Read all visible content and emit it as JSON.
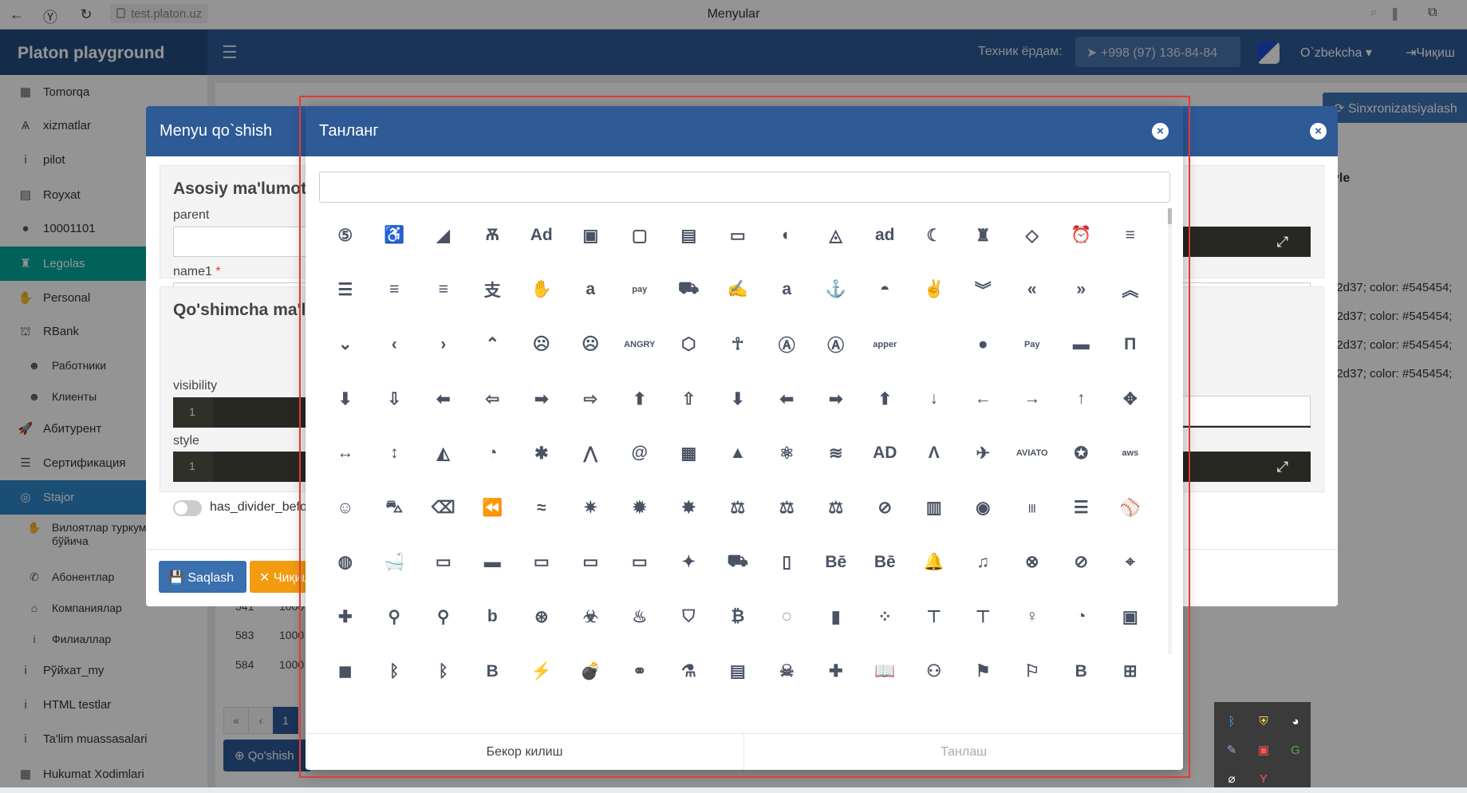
{
  "browser": {
    "url": "test.platon.uz",
    "title": "Menyular"
  },
  "header": {
    "brand": "Platon playground",
    "support_label": "Техник ёрдам:",
    "phone": "+998 (97) 136-84-84",
    "language": "O`zbekcha",
    "exit": "Чиқиш"
  },
  "sidebar": {
    "items": [
      {
        "label": "Tomorqa",
        "icon": "building-icon"
      },
      {
        "label": "xizmatlar",
        "icon": "aviato-icon"
      },
      {
        "label": "pilot",
        "icon": "info-icon"
      },
      {
        "label": "Royxat",
        "icon": "id-card-icon"
      },
      {
        "label": "10001101",
        "icon": "bomb-icon"
      },
      {
        "label": "Legolas",
        "icon": "chess-icon"
      },
      {
        "label": "Personal",
        "icon": "hand-icon"
      },
      {
        "label": "RBank",
        "icon": "bank-icon"
      },
      {
        "label": "Работники",
        "icon": "users-icon"
      },
      {
        "label": "Клиенты",
        "icon": "users-icon"
      },
      {
        "label": "Абитурент",
        "icon": "rocket-icon"
      },
      {
        "label": "Сертификация",
        "icon": "database-icon"
      },
      {
        "label": "Stajor",
        "icon": "circle-icon"
      },
      {
        "label": "Вилоятлар туркуми бўйича",
        "icon": "hand-icon"
      },
      {
        "label": "Абонентлар",
        "icon": "phone-icon"
      },
      {
        "label": "Компаниялар",
        "icon": "industry-icon"
      },
      {
        "label": "Филиаллар",
        "icon": "info-icon"
      },
      {
        "label": "Рўйхат_my",
        "icon": "info-icon"
      },
      {
        "label": "HTML testlar",
        "icon": "info-icon"
      },
      {
        "label": "Ta'lim muassasalari",
        "icon": "info-icon"
      },
      {
        "label": "Hukumat Xodimlari",
        "icon": "building-icon"
      }
    ]
  },
  "background": {
    "sync_button": "Sinxronizatsiyalash",
    "style_header": "yle",
    "style_rows": [
      "42d37; color: #545454;",
      "42d37; color: #545454;",
      "42d37; color: #545454;",
      "42d37; color: #545454;"
    ],
    "rows": [
      {
        "id": "541",
        "val": "1000"
      },
      {
        "id": "583",
        "val": "1000"
      },
      {
        "id": "584",
        "val": "1000"
      }
    ],
    "pager": [
      "«",
      "‹",
      "1"
    ],
    "add_button": "Qo'shish"
  },
  "modal_menu": {
    "title": "Menyu qo`shish",
    "section1_title": "Asosiy ma'lumotlar",
    "parent_label": "parent",
    "name1_label": "name1",
    "required_mark": "*",
    "section2_title": "Qo'shimcha ma'lumotlar",
    "visibility_label": "visibility",
    "style_label": "style",
    "line_no": "1",
    "toggle_label": "has_divider_before",
    "save": "Saqlash",
    "cancel": "Чиқиш"
  },
  "modal_icon": {
    "title": "Танланг",
    "search_value": "",
    "search_placeholder": "",
    "cancel": "Бекор килиш",
    "confirm": "Танлаш",
    "icons": [
      {
        "name": "500px-icon",
        "g": "⑤"
      },
      {
        "name": "accessible-icon",
        "g": "♿"
      },
      {
        "name": "accusoft-icon",
        "g": "◢"
      },
      {
        "name": "acquisitions-icon",
        "g": "Ѫ"
      },
      {
        "name": "ad-icon",
        "g": "Ad"
      },
      {
        "name": "address-book-icon",
        "g": "▣"
      },
      {
        "name": "address-book-outline-icon",
        "g": "▢"
      },
      {
        "name": "address-card-icon",
        "g": "▤"
      },
      {
        "name": "address-card-outline-icon",
        "g": "▭"
      },
      {
        "name": "adjust-icon",
        "g": "◐"
      },
      {
        "name": "adn-icon",
        "g": "◬"
      },
      {
        "name": "adversal-icon",
        "g": "ad"
      },
      {
        "name": "affiliatetheme-icon",
        "g": "☾"
      },
      {
        "name": "air-freshener-icon",
        "g": "♜"
      },
      {
        "name": "airbnb-icon",
        "g": "◇"
      },
      {
        "name": "alarm-clock-icon",
        "g": "⏰"
      },
      {
        "name": "align-center-icon",
        "g": "≡"
      },
      {
        "name": "align-justify-icon",
        "g": "☰"
      },
      {
        "name": "align-left-icon",
        "g": "≡"
      },
      {
        "name": "align-right-icon",
        "g": "≡"
      },
      {
        "name": "alipay-icon",
        "g": "支"
      },
      {
        "name": "allergies-icon",
        "g": "✋"
      },
      {
        "name": "amazon-icon",
        "g": "a"
      },
      {
        "name": "amazon-pay-icon",
        "g": "pay"
      },
      {
        "name": "ambulance-icon",
        "g": "⛟"
      },
      {
        "name": "american-sign-icon",
        "g": "✍"
      },
      {
        "name": "amilia-icon",
        "g": "a"
      },
      {
        "name": "anchor-icon",
        "g": "⚓"
      },
      {
        "name": "android-icon",
        "g": "◓"
      },
      {
        "name": "angellist-icon",
        "g": "✌"
      },
      {
        "name": "angle-double-down-icon",
        "g": "︾"
      },
      {
        "name": "angle-double-left-icon",
        "g": "«"
      },
      {
        "name": "angle-double-right-icon",
        "g": "»"
      },
      {
        "name": "angle-double-up-icon",
        "g": "︽"
      },
      {
        "name": "angle-down-icon",
        "g": "⌄"
      },
      {
        "name": "angle-left-icon",
        "g": "‹"
      },
      {
        "name": "angle-right-icon",
        "g": "›"
      },
      {
        "name": "angle-up-icon",
        "g": "⌃"
      },
      {
        "name": "angry-icon",
        "g": "☹"
      },
      {
        "name": "angry-outline-icon",
        "g": "☹"
      },
      {
        "name": "angrycreative-icon",
        "g": "ANGRY"
      },
      {
        "name": "angular-icon",
        "g": "⬡"
      },
      {
        "name": "ankh-icon",
        "g": "☥"
      },
      {
        "name": "app-store-icon",
        "g": "Ⓐ"
      },
      {
        "name": "app-store-ios-icon",
        "g": "Ⓐ"
      },
      {
        "name": "apper-icon",
        "g": "apper"
      },
      {
        "name": "apple-icon",
        "g": ""
      },
      {
        "name": "apple-alt-icon",
        "g": "●"
      },
      {
        "name": "apple-pay-icon",
        "g": "Pay"
      },
      {
        "name": "archive-icon",
        "g": "▬"
      },
      {
        "name": "archway-icon",
        "g": "Π"
      },
      {
        "name": "arrow-circle-down-icon",
        "g": "⬇"
      },
      {
        "name": "arrow-circle-down-outline-icon",
        "g": "⇩"
      },
      {
        "name": "arrow-circle-left-icon",
        "g": "⬅"
      },
      {
        "name": "arrow-circle-left-outline-icon",
        "g": "⇦"
      },
      {
        "name": "arrow-circle-right-icon",
        "g": "➡"
      },
      {
        "name": "arrow-circle-right-outline-icon",
        "g": "⇨"
      },
      {
        "name": "arrow-circle-up-icon",
        "g": "⬆"
      },
      {
        "name": "arrow-circle-up-outline-icon",
        "g": "⇧"
      },
      {
        "name": "arrow-alt-circle-down-icon",
        "g": "⬇"
      },
      {
        "name": "arrow-alt-circle-left-icon",
        "g": "⬅"
      },
      {
        "name": "arrow-alt-circle-right-icon",
        "g": "➡"
      },
      {
        "name": "arrow-alt-circle-up-icon",
        "g": "⬆"
      },
      {
        "name": "arrow-down-icon",
        "g": "↓"
      },
      {
        "name": "arrow-left-icon",
        "g": "←"
      },
      {
        "name": "arrow-right-icon",
        "g": "→"
      },
      {
        "name": "arrow-up-icon",
        "g": "↑"
      },
      {
        "name": "arrows-icon",
        "g": "✥"
      },
      {
        "name": "arrows-h-icon",
        "g": "↔"
      },
      {
        "name": "arrows-v-icon",
        "g": "↕"
      },
      {
        "name": "artstation-icon",
        "g": "◭"
      },
      {
        "name": "assistive-listening-icon",
        "g": "◔"
      },
      {
        "name": "asterisk-icon",
        "g": "✱"
      },
      {
        "name": "asymmetrik-icon",
        "g": "⋀"
      },
      {
        "name": "at-icon",
        "g": "@"
      },
      {
        "name": "atlas-icon",
        "g": "▦"
      },
      {
        "name": "atlassian-icon",
        "g": "▲"
      },
      {
        "name": "atom-icon",
        "g": "⚛"
      },
      {
        "name": "audible-icon",
        "g": "≋"
      },
      {
        "name": "audio-description-icon",
        "g": "AD"
      },
      {
        "name": "autoprefixer-icon",
        "g": "Ʌ"
      },
      {
        "name": "avianex-icon",
        "g": "✈"
      },
      {
        "name": "aviato-icon",
        "g": "AVIATO"
      },
      {
        "name": "award-icon",
        "g": "✪"
      },
      {
        "name": "aws-icon",
        "g": "aws"
      },
      {
        "name": "baby-icon",
        "g": "☺"
      },
      {
        "name": "baby-carriage-icon",
        "g": "⛍"
      },
      {
        "name": "backspace-icon",
        "g": "⌫"
      },
      {
        "name": "backward-icon",
        "g": "⏪"
      },
      {
        "name": "bacon-icon",
        "g": "≈"
      },
      {
        "name": "bacteria-icon",
        "g": "✷"
      },
      {
        "name": "bacterium-icon",
        "g": "✹"
      },
      {
        "name": "bahai-icon",
        "g": "✸"
      },
      {
        "name": "balance-scale-icon",
        "g": "⚖"
      },
      {
        "name": "balance-scale-left-icon",
        "g": "⚖"
      },
      {
        "name": "balance-scale-right-icon",
        "g": "⚖"
      },
      {
        "name": "ban-icon",
        "g": "⊘"
      },
      {
        "name": "band-aid-icon",
        "g": "▥"
      },
      {
        "name": "bandcamp-icon",
        "g": "◉"
      },
      {
        "name": "barcode-icon",
        "g": "|||"
      },
      {
        "name": "bars-icon",
        "g": "☰"
      },
      {
        "name": "baseball-icon",
        "g": "⚾"
      },
      {
        "name": "basketball-icon",
        "g": "◍"
      },
      {
        "name": "bath-icon",
        "g": "🛁"
      },
      {
        "name": "battery-empty-icon",
        "g": "▭"
      },
      {
        "name": "battery-full-icon",
        "g": "▬"
      },
      {
        "name": "battery-half-icon",
        "g": "▭"
      },
      {
        "name": "battery-quarter-icon",
        "g": "▭"
      },
      {
        "name": "battery-three-quarters-icon",
        "g": "▭"
      },
      {
        "name": "battle-net-icon",
        "g": "✦"
      },
      {
        "name": "bed-icon",
        "g": "⛟"
      },
      {
        "name": "beer-icon",
        "g": "▯"
      },
      {
        "name": "behance-icon",
        "g": "Bē"
      },
      {
        "name": "behance-square-icon",
        "g": "Bē"
      },
      {
        "name": "bell-icon",
        "g": "🔔"
      },
      {
        "name": "bell-outline-icon",
        "g": "♫"
      },
      {
        "name": "bell-slash-icon",
        "g": "⊗"
      },
      {
        "name": "bell-slash-outline-icon",
        "g": "⊘"
      },
      {
        "name": "bezier-curve-icon",
        "g": "⌖"
      },
      {
        "name": "bible-icon",
        "g": "✚"
      },
      {
        "name": "bicycle-icon",
        "g": "⚲"
      },
      {
        "name": "biking-icon",
        "g": "⚲"
      },
      {
        "name": "bimobject-icon",
        "g": "b"
      },
      {
        "name": "binoculars-icon",
        "g": "⊛"
      },
      {
        "name": "biohazard-icon",
        "g": "☣"
      },
      {
        "name": "birthday-cake-icon",
        "g": "♨"
      },
      {
        "name": "bitbucket-icon",
        "g": "⛉"
      },
      {
        "name": "bitcoin-icon",
        "g": "₿"
      },
      {
        "name": "bity-icon",
        "g": "◌"
      },
      {
        "name": "black-tie-icon",
        "g": "▮"
      },
      {
        "name": "blackberry-icon",
        "g": "⁘"
      },
      {
        "name": "blender-icon",
        "g": "⊤"
      },
      {
        "name": "blender-phone-icon",
        "g": "⊤"
      },
      {
        "name": "blind-icon",
        "g": "♀"
      },
      {
        "name": "blog-icon",
        "g": "◔"
      },
      {
        "name": "blogger-icon",
        "g": "▣"
      },
      {
        "name": "blogger-b-icon",
        "g": "◼"
      },
      {
        "name": "bluetooth-icon",
        "g": "ᛒ"
      },
      {
        "name": "bluetooth-b-icon",
        "g": "ᛒ"
      },
      {
        "name": "bold-icon",
        "g": "B"
      },
      {
        "name": "bolt-icon",
        "g": "⚡"
      },
      {
        "name": "bomb-icon",
        "g": "💣"
      },
      {
        "name": "bone-icon",
        "g": "⚭"
      },
      {
        "name": "bong-icon",
        "g": "⚗"
      },
      {
        "name": "book-icon",
        "g": "▤"
      },
      {
        "name": "book-dead-icon",
        "g": "☠"
      },
      {
        "name": "book-medical-icon",
        "g": "✚"
      },
      {
        "name": "book-open-icon",
        "g": "📖"
      },
      {
        "name": "book-reader-icon",
        "g": "⚇"
      },
      {
        "name": "bookmark-icon",
        "g": "⚑"
      },
      {
        "name": "bookmark-outline-icon",
        "g": "⚐"
      },
      {
        "name": "bootstrap-icon",
        "g": "B"
      },
      {
        "name": "border-all-icon",
        "g": "⊞"
      },
      {
        "name": "border-none-icon",
        "g": "⁝"
      },
      {
        "name": "border-style-icon",
        "g": "⌜"
      },
      {
        "name": "bowling-ball-icon",
        "g": "●"
      },
      {
        "name": "box-icon",
        "g": "▬"
      },
      {
        "name": "box-open-icon",
        "g": "◫"
      },
      {
        "name": "boxes-icon",
        "g": "▦"
      },
      {
        "name": "braille-icon",
        "g": "⠿"
      },
      {
        "name": "brain-icon",
        "g": "◕"
      },
      {
        "name": "bread-slice-icon",
        "g": "⬭"
      },
      {
        "name": "briefcase-icon",
        "g": "▬"
      },
      {
        "name": "briefcase-medical-icon",
        "g": "✚"
      },
      {
        "name": "broadcast-tower-icon",
        "g": "((·))"
      },
      {
        "name": "broom-icon",
        "g": "⟋"
      },
      {
        "name": "brush-icon",
        "g": "▬"
      },
      {
        "name": "btc-icon",
        "g": "₿"
      },
      {
        "name": "buffer-icon",
        "g": "≡"
      },
      {
        "name": "bug-icon",
        "g": "✲"
      }
    ]
  },
  "tray": {
    "icons": [
      "bluetooth-icon",
      "shield-icon",
      "sync-icon",
      "pen-icon",
      "video-icon",
      "g-icon",
      "wifi-off-icon",
      "yandex-icon",
      ""
    ]
  },
  "colors": {
    "primary": "#2e5a96",
    "accent": "#00a99d",
    "selected": "#2d87c8",
    "highlight": "#e53935"
  }
}
